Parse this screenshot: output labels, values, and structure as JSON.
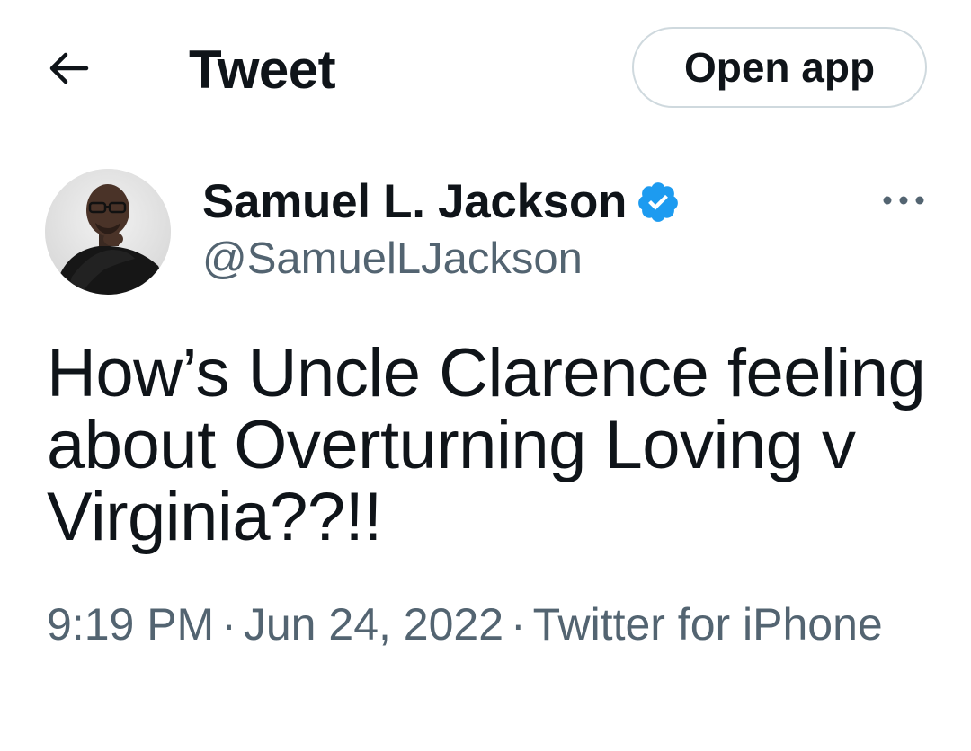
{
  "header": {
    "back_icon": "arrow-left-icon",
    "title": "Tweet",
    "open_app_label": "Open app"
  },
  "author": {
    "display_name": "Samuel L. Jackson",
    "handle": "@SamuelLJackson",
    "verified_icon": "verified-badge-icon",
    "verified_color": "#1d9bf0",
    "more_icon": "more-horizontal-icon"
  },
  "tweet": {
    "text": "How’s Uncle Clarence feeling about Overturning Loving v Virginia??!!",
    "time": "9:19 PM",
    "separator": "·",
    "date": "Jun 24, 2022",
    "source": "Twitter for iPhone"
  },
  "colors": {
    "text_primary": "#0f1419",
    "text_secondary": "#536471",
    "border": "#cfd9de"
  }
}
